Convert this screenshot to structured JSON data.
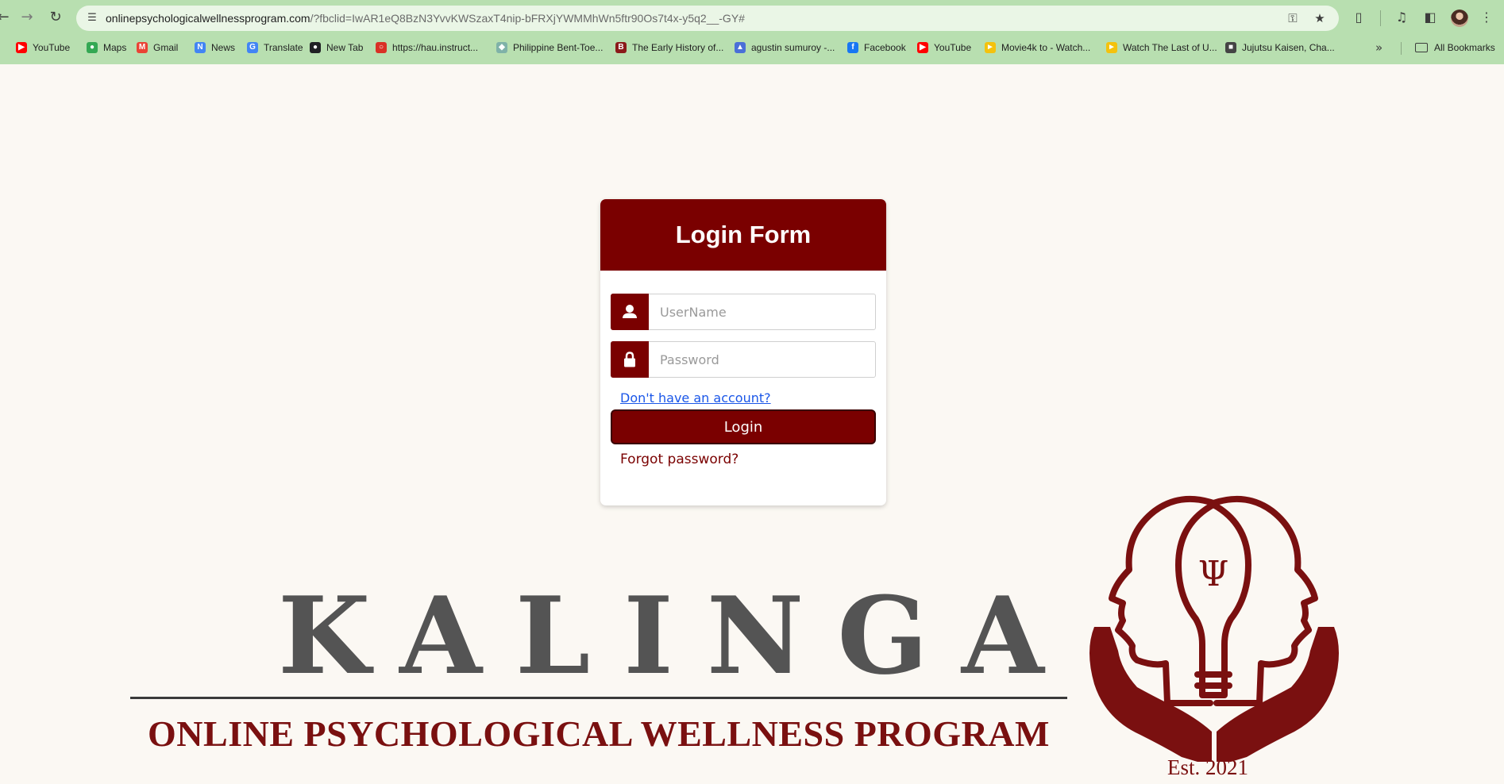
{
  "browser": {
    "url_host": "onlinepsychologicalwellnessprogram.com",
    "url_rest": "/?fbclid=IwAR1eQ8BzN3YvvKWSzaxT4nip-bFRXjYWMMhWn5ftr90Os7t4x-y5q2__-GY#",
    "bookmarks": [
      {
        "label": "YouTube",
        "icon": "youtube-icon",
        "color": "#ff0000"
      },
      {
        "label": "Maps",
        "icon": "maps-icon",
        "color": "#34a853"
      },
      {
        "label": "Gmail",
        "icon": "gmail-icon",
        "color": "#ea4335"
      },
      {
        "label": "News",
        "icon": "news-icon",
        "color": "#4285f4"
      },
      {
        "label": "Translate",
        "icon": "translate-icon",
        "color": "#4285f4"
      },
      {
        "label": "New Tab",
        "icon": "globe-icon",
        "color": "#202124"
      },
      {
        "label": "https://hau.instruct...",
        "icon": "loading-icon",
        "color": "#d93025"
      },
      {
        "label": "Philippine Bent-Toe...",
        "icon": "gecko-icon",
        "color": "#7fb2a8"
      },
      {
        "label": "The Early History of...",
        "icon": "book-icon",
        "color": "#8b1a1a"
      },
      {
        "label": "agustin sumuroy -...",
        "icon": "academia-icon",
        "color": "#4a6fd8"
      },
      {
        "label": "Facebook",
        "icon": "facebook-icon",
        "color": "#1877f2"
      },
      {
        "label": "YouTube",
        "icon": "youtube-icon",
        "color": "#ff0000"
      },
      {
        "label": "Movie4k to - Watch...",
        "icon": "movie-icon",
        "color": "#f4c20d"
      },
      {
        "label": "Watch The Last of U...",
        "icon": "movie-icon",
        "color": "#f4c20d"
      },
      {
        "label": "Jujutsu Kaisen, Cha...",
        "icon": "anime-icon",
        "color": "#444444"
      }
    ],
    "all_bookmarks": "All Bookmarks"
  },
  "login": {
    "title": "Login Form",
    "username_placeholder": "UserName",
    "password_placeholder": "Password",
    "signup_link": "Don't have an account?",
    "login_button": "Login",
    "forgot_link": "Forgot password?"
  },
  "brand": {
    "name": "KALINGA",
    "tagline": "ONLINE PSYCHOLOGICAL WELLNESS PROGRAM",
    "established": "Est. 2021"
  },
  "colors": {
    "accent": "#7a0000",
    "page_bg": "#fbf8f3",
    "chrome_bg": "#b8dfb0",
    "link": "#1a56e8"
  }
}
